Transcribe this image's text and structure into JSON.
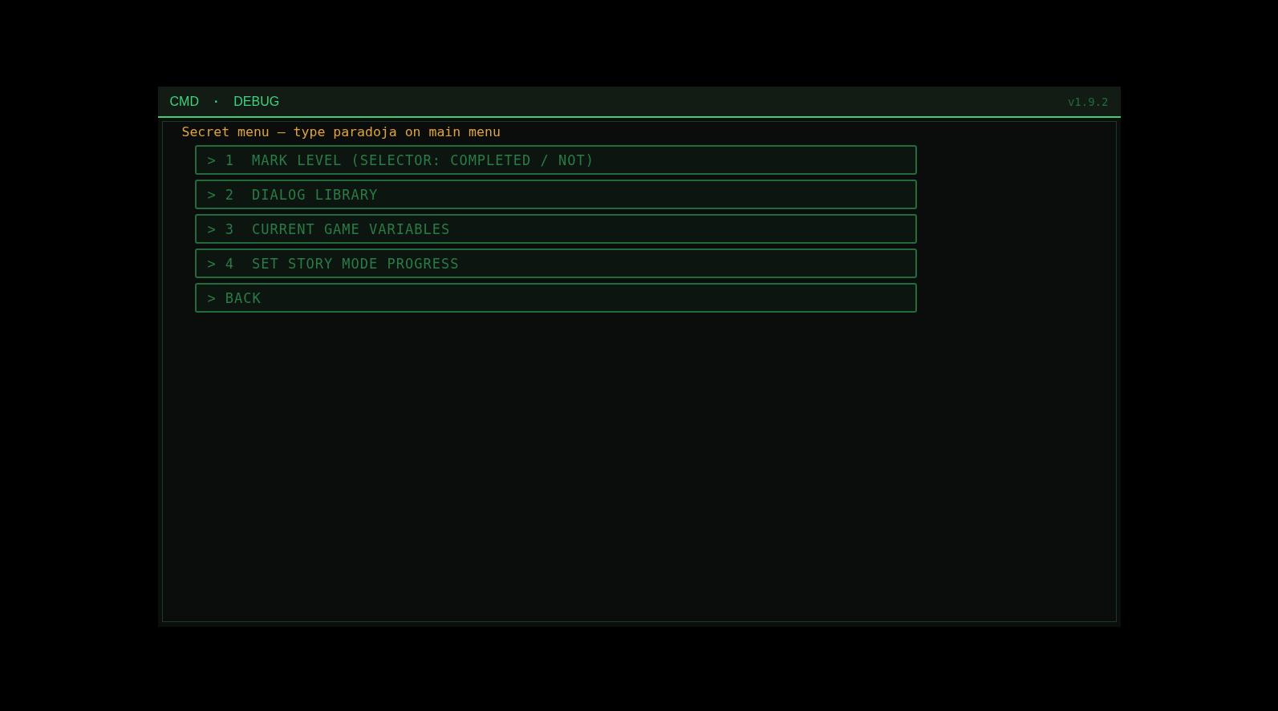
{
  "header": {
    "breadcrumb": [
      "CMD",
      "DEBUG"
    ],
    "separator": "·",
    "version": "v1.9.2"
  },
  "hint": "Secret menu — type paradoja on main menu",
  "menu": [
    {
      "marker": ">",
      "number": "1",
      "label": "MARK LEVEL (SELECTOR: COMPLETED / NOT)"
    },
    {
      "marker": ">",
      "number": "2",
      "label": "DIALOG LIBRARY"
    },
    {
      "marker": ">",
      "number": "3",
      "label": "CURRENT GAME VARIABLES"
    },
    {
      "marker": ">",
      "number": "4",
      "label": "SET STORY MODE PROGRESS"
    },
    {
      "marker": ">",
      "label": "BACK"
    }
  ]
}
